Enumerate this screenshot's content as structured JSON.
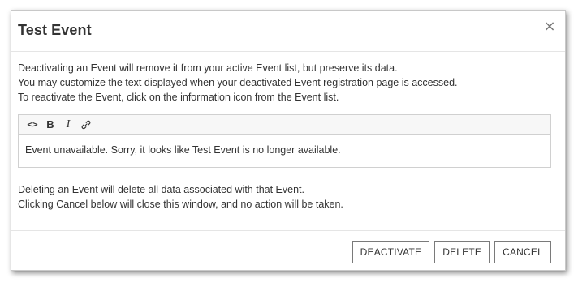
{
  "dialog": {
    "title": "Test Event",
    "close_label": "×",
    "intro_lines": [
      "Deactivating an Event will remove it from your active Event list, but preserve its data.",
      "You may customize the text displayed when your deactivated Event registration page is accessed.",
      "To reactivate the Event, click on the information icon from the Event list."
    ],
    "editor": {
      "toolbar": {
        "code_label": "<>",
        "bold_label": "B",
        "italic_label": "I",
        "link_icon": "link-icon"
      },
      "content": "Event unavailable. Sorry, it looks like Test Event is no longer available."
    },
    "warning_lines": [
      "Deleting an Event will delete all data associated with that Event.",
      "Clicking Cancel below will close this window, and no action will be taken."
    ],
    "buttons": {
      "deactivate": "DEACTIVATE",
      "delete": "DELETE",
      "cancel": "CANCEL"
    }
  }
}
